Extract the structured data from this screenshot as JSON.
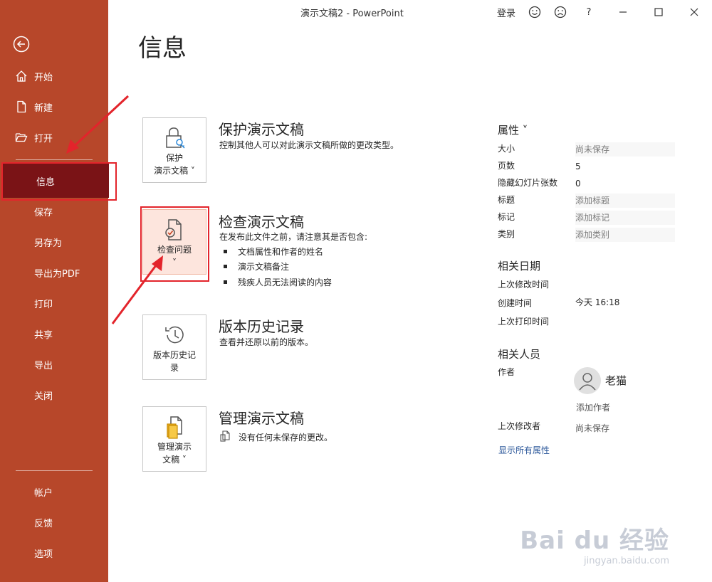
{
  "window": {
    "title": "演示文稿2  -  PowerPoint",
    "signin": "登录",
    "help": "?"
  },
  "sidebar": {
    "items": [
      {
        "label": "开始",
        "icon": "home-icon"
      },
      {
        "label": "新建",
        "icon": "new-file-icon"
      },
      {
        "label": "打开",
        "icon": "folder-open-icon"
      },
      {
        "label": "信息"
      },
      {
        "label": "保存"
      },
      {
        "label": "另存为"
      },
      {
        "label": "导出为PDF"
      },
      {
        "label": "打印"
      },
      {
        "label": "共享"
      },
      {
        "label": "导出"
      },
      {
        "label": "关闭"
      }
    ],
    "bottom_items": [
      {
        "label": "帐户"
      },
      {
        "label": "反馈"
      },
      {
        "label": "选项"
      }
    ],
    "active_color": "#7a1316",
    "bg_color": "#b7472a"
  },
  "main": {
    "title": "信息",
    "sections": [
      {
        "tile_label_1": "保护",
        "tile_label_2": "演示文稿 ˅",
        "title": "保护演示文稿",
        "desc": "控制其他人可以对此演示文稿所做的更改类型。"
      },
      {
        "tile_label_1": "检查问题",
        "tile_label_2": "˅",
        "title": "检查演示文稿",
        "desc": "在发布此文件之前，请注意其是否包含:",
        "bullets": [
          "文档属性和作者的姓名",
          "演示文稿备注",
          "残疾人员无法阅读的内容"
        ]
      },
      {
        "tile_label_1": "版本历史记",
        "tile_label_2": "录",
        "title": "版本历史记录",
        "desc": "查看并还原以前的版本。"
      },
      {
        "tile_label_1": "管理演示",
        "tile_label_2": "文稿 ˅",
        "title": "管理演示文稿",
        "desc": "没有任何未保存的更改。"
      }
    ]
  },
  "properties": {
    "header": "属性 ˅",
    "rows": [
      {
        "key": "大小",
        "value": "尚未保存"
      },
      {
        "key": "页数",
        "value": "5"
      },
      {
        "key": "隐藏幻灯片张数",
        "value": "0"
      },
      {
        "key": "标题",
        "value": "添加标题"
      },
      {
        "key": "标记",
        "value": "添加标记"
      },
      {
        "key": "类别",
        "value": "添加类别"
      }
    ],
    "dates_header": "相关日期",
    "dates": [
      {
        "key": "上次修改时间",
        "value": ""
      },
      {
        "key": "创建时间",
        "value": "今天 16:18"
      },
      {
        "key": "上次打印时间",
        "value": ""
      }
    ],
    "people_header": "相关人员",
    "author_key": "作者",
    "author_name": "老猫",
    "add_author": "添加作者",
    "last_modified_by_key": "上次修改者",
    "last_modified_by_value": "尚未保存",
    "show_all": "显示所有属性"
  },
  "watermark": {
    "brand": "Bai du 经验",
    "url": "jingyan.baidu.com"
  }
}
